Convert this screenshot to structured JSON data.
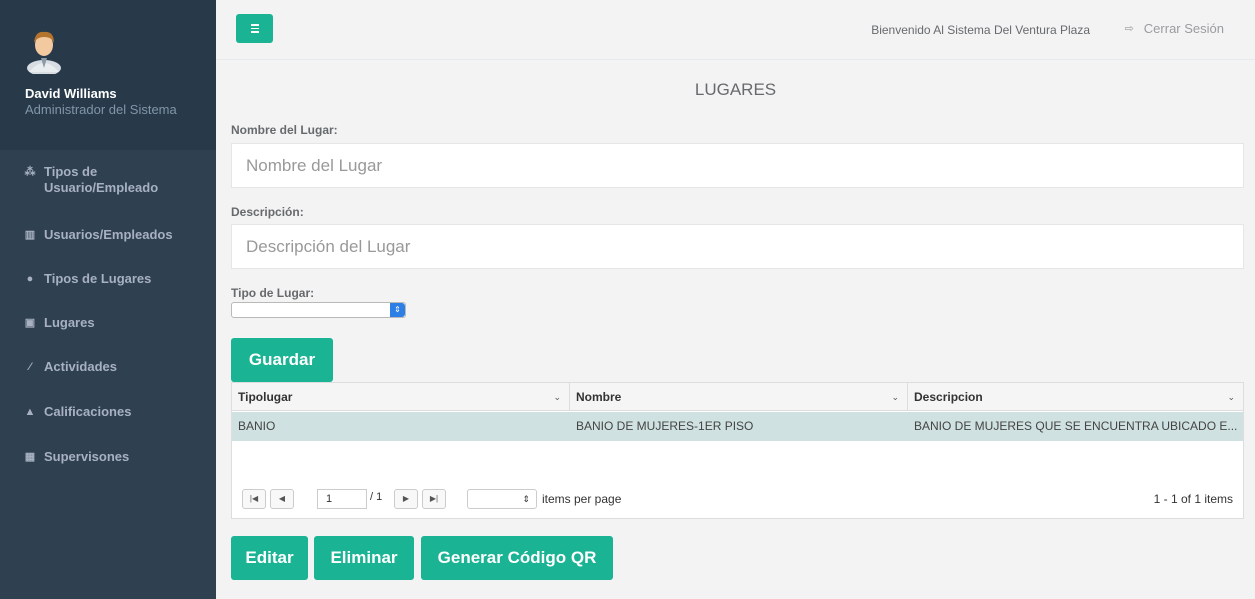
{
  "profile": {
    "name": "David Williams",
    "role": "Administrador del Sistema"
  },
  "sidebar": {
    "items": [
      {
        "label": "Tipos de Usuario/Empleado",
        "icon": "sitemap-icon",
        "glyph": "⁂"
      },
      {
        "label": "Usuarios/Empleados",
        "icon": "bar-chart-icon",
        "glyph": "▥"
      },
      {
        "label": "Tipos de Lugares",
        "icon": "globe-icon",
        "glyph": "●"
      },
      {
        "label": "Lugares",
        "icon": "image-icon",
        "glyph": "▣"
      },
      {
        "label": "Actividades",
        "icon": "magic-wand-icon",
        "glyph": "⁄"
      },
      {
        "label": "Calificaciones",
        "icon": "flask-icon",
        "glyph": "▲"
      },
      {
        "label": "Supervisones",
        "icon": "table-icon",
        "glyph": "▦"
      }
    ]
  },
  "header": {
    "welcome": "Bienvenido Al Sistema Del Ventura Plaza",
    "logout": "Cerrar Sesión"
  },
  "page": {
    "title": "LUGARES"
  },
  "form": {
    "name_label": "Nombre del Lugar:",
    "name_placeholder": "Nombre del Lugar",
    "desc_label": "Descripción:",
    "desc_placeholder": "Descripción del Lugar",
    "type_label": "Tipo de Lugar:",
    "type_value": "",
    "save_label": "Guardar"
  },
  "grid": {
    "columns": [
      "Tipolugar",
      "Nombre",
      "Descripcion"
    ],
    "rows": [
      [
        "BANIO",
        "BANIO DE MUJERES-1ER PISO",
        "BANIO DE MUJERES QUE SE ENCUENTRA UBICADO E..."
      ]
    ],
    "pager": {
      "page": "1",
      "total": "/ 1",
      "per_page_value": "",
      "per_page_label": "items per page",
      "range": "1 - 1 of 1 items"
    }
  },
  "actions": {
    "edit": "Editar",
    "delete": "Eliminar",
    "qr": "Generar Código QR"
  },
  "colors": {
    "accent": "#1ab394",
    "sidebar": "#2f4050",
    "selected_row": "#cfe1e0"
  }
}
